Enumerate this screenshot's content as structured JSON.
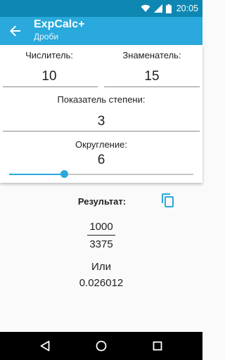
{
  "status_bar": {
    "time": "20:05"
  },
  "app_bar": {
    "title": "ExpCalc+",
    "subtitle": "Дроби"
  },
  "inputs": {
    "numerator": {
      "label": "Числитель:",
      "value": "10"
    },
    "denominator": {
      "label": "Знаменатель:",
      "value": "15"
    },
    "exponent": {
      "label": "Показатель степени:",
      "value": "3"
    },
    "rounding": {
      "label": "Округление:",
      "value": "6",
      "slider_fraction": 0.3
    }
  },
  "result": {
    "label": "Результат:",
    "numerator": "1000",
    "denominator": "3375",
    "or_label": "Или",
    "decimal": "0.026012"
  },
  "colors": {
    "accent": "#29a9dc",
    "status_bar": "#0f87b3"
  }
}
